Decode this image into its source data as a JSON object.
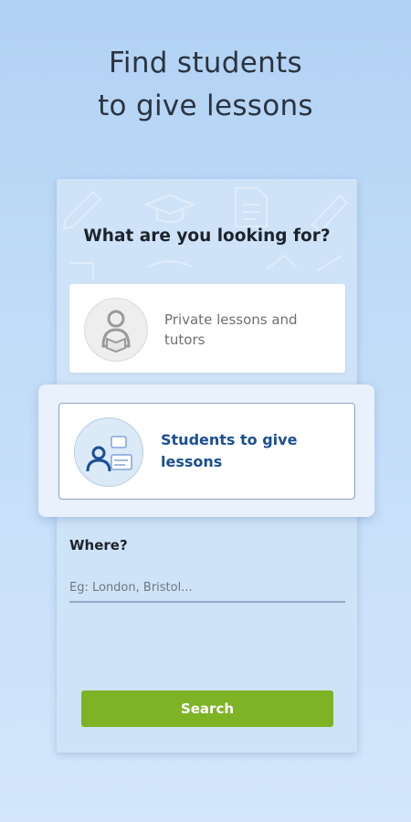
{
  "headline": {
    "line1": "Find students",
    "line2": "to give lessons"
  },
  "form": {
    "question": "What are you looking for?",
    "options": [
      {
        "label_line1": "Private lessons and",
        "label_line2": "tutors",
        "icon": "person-reading-icon",
        "selected": false
      },
      {
        "label_line1": "Students to give",
        "label_line2": "lessons",
        "icon": "teacher-whiteboard-icon",
        "selected": true
      }
    ],
    "where_label": "Where?",
    "where_placeholder": "Eg: London, Bristol...",
    "where_value": "",
    "search_label": "Search"
  },
  "colors": {
    "accent_green": "#7db324",
    "selected_text": "#1b4f94",
    "background": "#b2d2f4"
  }
}
